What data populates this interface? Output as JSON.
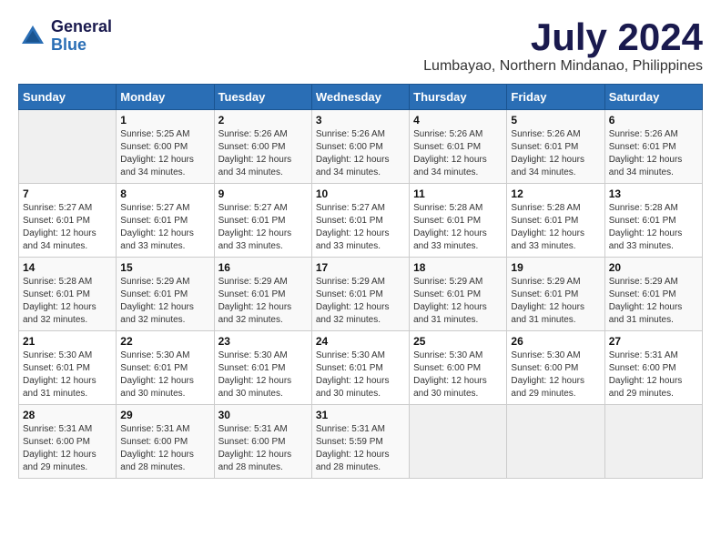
{
  "header": {
    "logo_line1": "General",
    "logo_line2": "Blue",
    "month": "July 2024",
    "location": "Lumbayao, Northern Mindanao, Philippines"
  },
  "calendar": {
    "weekdays": [
      "Sunday",
      "Monday",
      "Tuesday",
      "Wednesday",
      "Thursday",
      "Friday",
      "Saturday"
    ],
    "weeks": [
      [
        {
          "day": "",
          "info": ""
        },
        {
          "day": "1",
          "info": "Sunrise: 5:25 AM\nSunset: 6:00 PM\nDaylight: 12 hours\nand 34 minutes."
        },
        {
          "day": "2",
          "info": "Sunrise: 5:26 AM\nSunset: 6:00 PM\nDaylight: 12 hours\nand 34 minutes."
        },
        {
          "day": "3",
          "info": "Sunrise: 5:26 AM\nSunset: 6:00 PM\nDaylight: 12 hours\nand 34 minutes."
        },
        {
          "day": "4",
          "info": "Sunrise: 5:26 AM\nSunset: 6:01 PM\nDaylight: 12 hours\nand 34 minutes."
        },
        {
          "day": "5",
          "info": "Sunrise: 5:26 AM\nSunset: 6:01 PM\nDaylight: 12 hours\nand 34 minutes."
        },
        {
          "day": "6",
          "info": "Sunrise: 5:26 AM\nSunset: 6:01 PM\nDaylight: 12 hours\nand 34 minutes."
        }
      ],
      [
        {
          "day": "7",
          "info": "Sunrise: 5:27 AM\nSunset: 6:01 PM\nDaylight: 12 hours\nand 34 minutes."
        },
        {
          "day": "8",
          "info": "Sunrise: 5:27 AM\nSunset: 6:01 PM\nDaylight: 12 hours\nand 33 minutes."
        },
        {
          "day": "9",
          "info": "Sunrise: 5:27 AM\nSunset: 6:01 PM\nDaylight: 12 hours\nand 33 minutes."
        },
        {
          "day": "10",
          "info": "Sunrise: 5:27 AM\nSunset: 6:01 PM\nDaylight: 12 hours\nand 33 minutes."
        },
        {
          "day": "11",
          "info": "Sunrise: 5:28 AM\nSunset: 6:01 PM\nDaylight: 12 hours\nand 33 minutes."
        },
        {
          "day": "12",
          "info": "Sunrise: 5:28 AM\nSunset: 6:01 PM\nDaylight: 12 hours\nand 33 minutes."
        },
        {
          "day": "13",
          "info": "Sunrise: 5:28 AM\nSunset: 6:01 PM\nDaylight: 12 hours\nand 33 minutes."
        }
      ],
      [
        {
          "day": "14",
          "info": "Sunrise: 5:28 AM\nSunset: 6:01 PM\nDaylight: 12 hours\nand 32 minutes."
        },
        {
          "day": "15",
          "info": "Sunrise: 5:29 AM\nSunset: 6:01 PM\nDaylight: 12 hours\nand 32 minutes."
        },
        {
          "day": "16",
          "info": "Sunrise: 5:29 AM\nSunset: 6:01 PM\nDaylight: 12 hours\nand 32 minutes."
        },
        {
          "day": "17",
          "info": "Sunrise: 5:29 AM\nSunset: 6:01 PM\nDaylight: 12 hours\nand 32 minutes."
        },
        {
          "day": "18",
          "info": "Sunrise: 5:29 AM\nSunset: 6:01 PM\nDaylight: 12 hours\nand 31 minutes."
        },
        {
          "day": "19",
          "info": "Sunrise: 5:29 AM\nSunset: 6:01 PM\nDaylight: 12 hours\nand 31 minutes."
        },
        {
          "day": "20",
          "info": "Sunrise: 5:29 AM\nSunset: 6:01 PM\nDaylight: 12 hours\nand 31 minutes."
        }
      ],
      [
        {
          "day": "21",
          "info": "Sunrise: 5:30 AM\nSunset: 6:01 PM\nDaylight: 12 hours\nand 31 minutes."
        },
        {
          "day": "22",
          "info": "Sunrise: 5:30 AM\nSunset: 6:01 PM\nDaylight: 12 hours\nand 30 minutes."
        },
        {
          "day": "23",
          "info": "Sunrise: 5:30 AM\nSunset: 6:01 PM\nDaylight: 12 hours\nand 30 minutes."
        },
        {
          "day": "24",
          "info": "Sunrise: 5:30 AM\nSunset: 6:01 PM\nDaylight: 12 hours\nand 30 minutes."
        },
        {
          "day": "25",
          "info": "Sunrise: 5:30 AM\nSunset: 6:00 PM\nDaylight: 12 hours\nand 30 minutes."
        },
        {
          "day": "26",
          "info": "Sunrise: 5:30 AM\nSunset: 6:00 PM\nDaylight: 12 hours\nand 29 minutes."
        },
        {
          "day": "27",
          "info": "Sunrise: 5:31 AM\nSunset: 6:00 PM\nDaylight: 12 hours\nand 29 minutes."
        }
      ],
      [
        {
          "day": "28",
          "info": "Sunrise: 5:31 AM\nSunset: 6:00 PM\nDaylight: 12 hours\nand 29 minutes."
        },
        {
          "day": "29",
          "info": "Sunrise: 5:31 AM\nSunset: 6:00 PM\nDaylight: 12 hours\nand 28 minutes."
        },
        {
          "day": "30",
          "info": "Sunrise: 5:31 AM\nSunset: 6:00 PM\nDaylight: 12 hours\nand 28 minutes."
        },
        {
          "day": "31",
          "info": "Sunrise: 5:31 AM\nSunset: 5:59 PM\nDaylight: 12 hours\nand 28 minutes."
        },
        {
          "day": "",
          "info": ""
        },
        {
          "day": "",
          "info": ""
        },
        {
          "day": "",
          "info": ""
        }
      ]
    ]
  }
}
